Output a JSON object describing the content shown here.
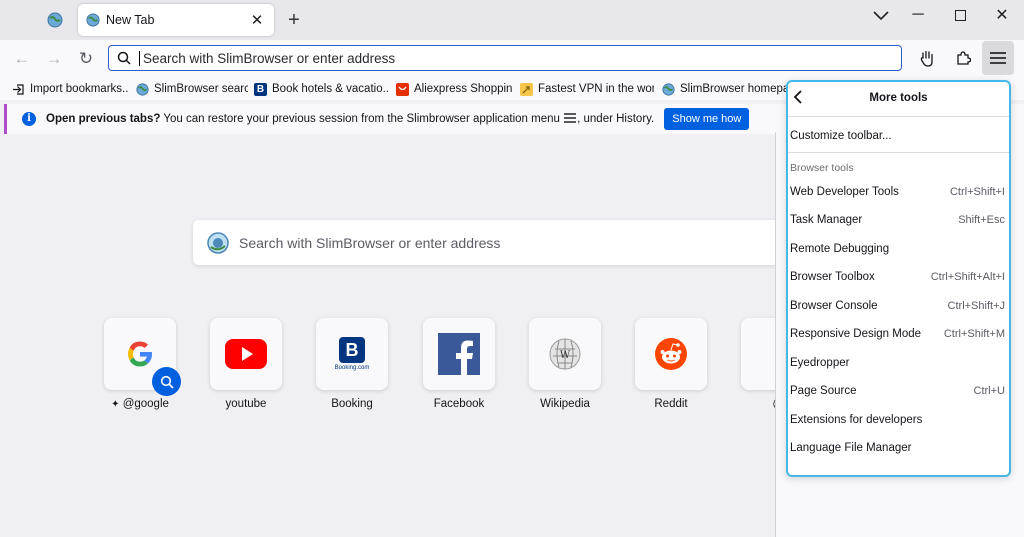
{
  "tabs": [
    {
      "label": "New Tab",
      "close_icon": "close-icon"
    }
  ],
  "navbar": {
    "url_placeholder": "Search with SlimBrowser or enter address"
  },
  "bookmarks": [
    {
      "label": "Import bookmarks...",
      "icon": "import-icon"
    },
    {
      "label": "SlimBrowser search",
      "icon": "globe-icon"
    },
    {
      "label": "Book hotels & vacatio...",
      "icon": "booking-icon"
    },
    {
      "label": "Aliexpress Shopping",
      "icon": "aliexpress-icon"
    },
    {
      "label": "Fastest VPN in the wor...",
      "icon": "vpn-icon"
    },
    {
      "label": "SlimBrowser homepa...",
      "icon": "globe-icon"
    }
  ],
  "notification": {
    "bold": "Open previous tabs?",
    "text": "You can restore your previous session from the Slimbrowser application menu",
    "tail": ", under History.",
    "button": "Show me how"
  },
  "home": {
    "search_placeholder": "Search with SlimBrowser or enter address",
    "tiles": [
      {
        "label": "@google",
        "icon": "google-icon"
      },
      {
        "label": "youtube",
        "icon": "youtube-icon"
      },
      {
        "label": "Booking",
        "icon": "booking-icon"
      },
      {
        "label": "Facebook",
        "icon": "facebook-icon"
      },
      {
        "label": "Wikipedia",
        "icon": "wikipedia-icon"
      },
      {
        "label": "Reddit",
        "icon": "reddit-icon"
      },
      {
        "label": "@an",
        "icon": "amazon-icon"
      }
    ],
    "booking_caption": "Booking.com"
  },
  "panel": {
    "title": "More tools",
    "customize": "Customize toolbar...",
    "section_label": "Browser tools",
    "items": [
      {
        "label": "Web Developer Tools",
        "shortcut": "Ctrl+Shift+I"
      },
      {
        "label": "Task Manager",
        "shortcut": "Shift+Esc"
      },
      {
        "label": "Remote Debugging",
        "shortcut": ""
      },
      {
        "label": "Browser Toolbox",
        "shortcut": "Ctrl+Shift+Alt+I"
      },
      {
        "label": "Browser Console",
        "shortcut": "Ctrl+Shift+J"
      },
      {
        "label": "Responsive Design Mode",
        "shortcut": "Ctrl+Shift+M"
      },
      {
        "label": "Eyedropper",
        "shortcut": ""
      },
      {
        "label": "Page Source",
        "shortcut": "Ctrl+U"
      },
      {
        "label": "Extensions for developers",
        "shortcut": ""
      },
      {
        "label": "Language File Manager",
        "shortcut": ""
      }
    ]
  },
  "colors": {
    "accent": "#0061e0",
    "panel_border": "#44b8e8",
    "notification_bar": "#ae4cc9"
  }
}
